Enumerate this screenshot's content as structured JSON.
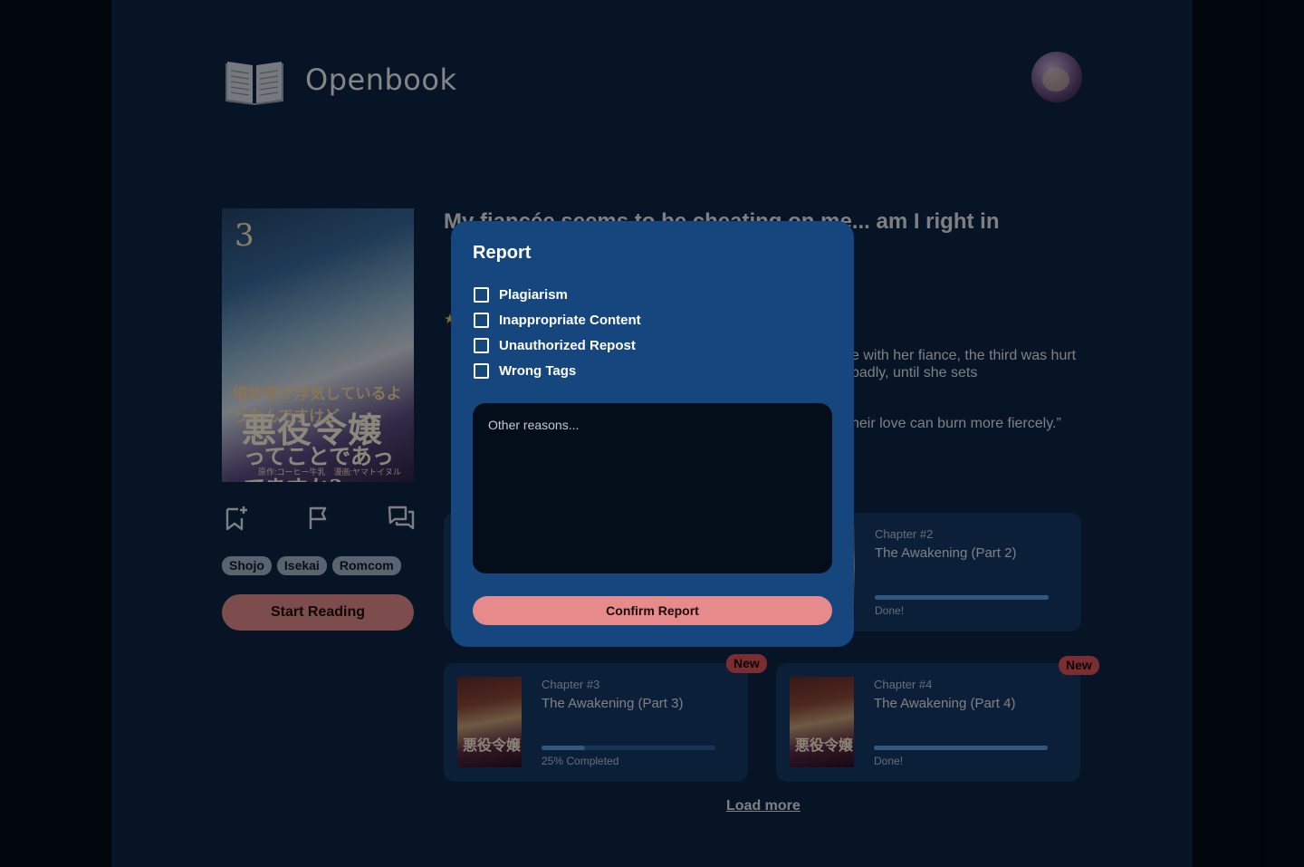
{
  "app": {
    "name": "Openbook"
  },
  "book": {
    "title": "My fiancée seems to be cheating on me... am I right in",
    "cover": {
      "volume": "3",
      "title_line1": "婚約者が浮気しているようなんですけど",
      "title_main": "悪役令嬢",
      "title_line3": "ってことであってますか?",
      "credits": "原作:コーヒー牛乳　漫画:ヤマトイヌル"
    },
    "tags": [
      "Shojo",
      "Isekai",
      "Romcom"
    ],
    "start_label": "Start Reading",
    "synopsis_visible": "e with her fiance, the third was hurt badly, until she sets",
    "quote_visible": "heir love can burn more fiercely.”"
  },
  "chapters": [
    {
      "number": "Chapter #2",
      "title": "The Awakening (Part 2)",
      "progress": 1.0,
      "status": "Done!",
      "is_new": false
    },
    {
      "number": "Chapter #3",
      "title": "The Awakening (Part 3)",
      "progress": 0.25,
      "status": "25% Completed",
      "is_new": true
    },
    {
      "number": "Chapter #4",
      "title": "The Awakening (Part 4)",
      "progress": 1.0,
      "status": "Done!",
      "is_new": true
    }
  ],
  "new_badge": "New",
  "load_more": "Load more",
  "icons": {
    "logo": "open-book-icon",
    "bookmark": "bookmark-add-icon",
    "flag": "flag-icon",
    "comments": "chat-bubbles-icon"
  },
  "modal": {
    "title": "Report",
    "options": [
      "Plagiarism",
      "Inappropriate Content",
      "Unauthorized Repost",
      "Wrong Tags"
    ],
    "textarea_placeholder": "Other reasons...",
    "confirm_label": "Confirm Report"
  },
  "colors": {
    "page_bg": "#0b2546",
    "modal_bg": "#16467e",
    "accent_pink": "#e78a8c",
    "badge_red": "#e1545a",
    "progress_blue": "#5aa0e6"
  }
}
